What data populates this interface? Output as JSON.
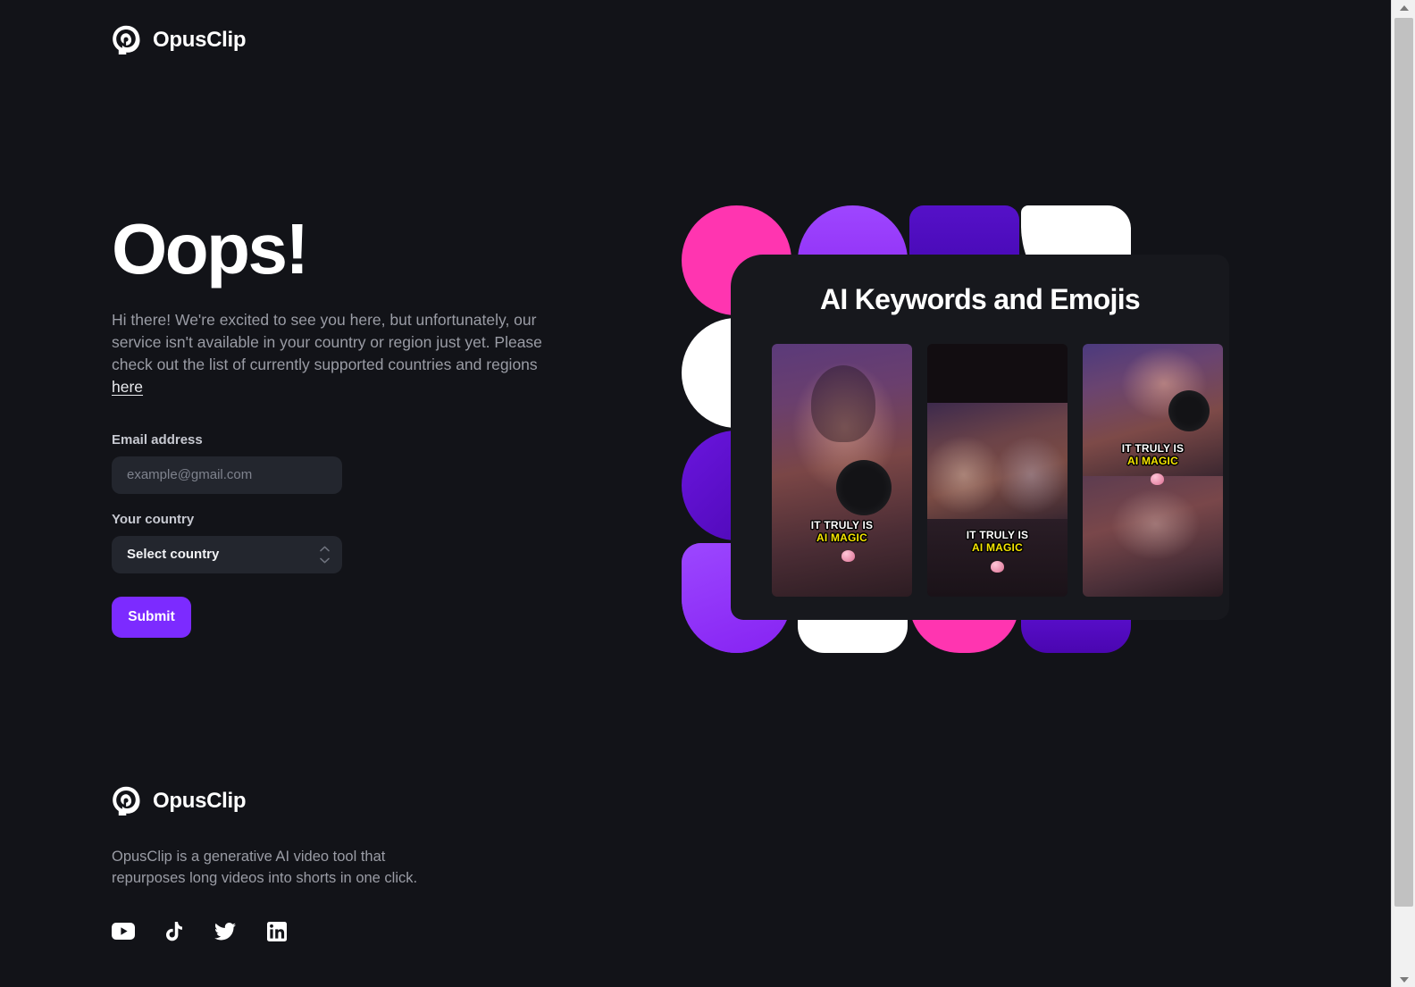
{
  "brand": {
    "name": "OpusClip",
    "logo_icon": "opusclip-p-logo-icon"
  },
  "main": {
    "headline": "Oops!",
    "body_text": "Hi there! We're excited to see you here, but unfortunately, our service isn't available in your country or region just yet. Please check out the list of currently supported countries and regions ",
    "body_link_text": "here"
  },
  "form": {
    "email_label": "Email address",
    "email_placeholder": "example@gmail.com",
    "email_value": "",
    "country_label": "Your country",
    "country_selected": "Select country",
    "country_chevron_up_icon": "chevron-up-icon",
    "country_chevron_down_icon": "chevron-down-icon",
    "submit_label": "Submit",
    "submit_color": "#7C2BFF"
  },
  "hero": {
    "card_title": "AI Keywords and Emojis",
    "thumbnails": [
      {
        "caption_line1": "IT TRULY IS",
        "caption_line2": "AI MAGIC"
      },
      {
        "caption_line1": "IT TRULY IS",
        "caption_line2": "AI MAGIC"
      },
      {
        "caption_line1": "IT TRULY IS",
        "caption_line2": "AI MAGIC"
      }
    ],
    "caption_line1_color": "#FFFFFF",
    "caption_line2_color": "#F5E500",
    "blob_colors": {
      "pink": "#FF35B0",
      "purple": "#9333F5",
      "indigo": "#4E0FB5",
      "bright_purple": "#8B2BF5",
      "white": "#FFFFFF"
    }
  },
  "footer": {
    "brand_name": "OpusClip",
    "description": "OpusClip is a generative AI video tool that repurposes long videos into shorts in one click.",
    "socials": [
      {
        "name": "youtube-icon",
        "label": "YouTube"
      },
      {
        "name": "tiktok-icon",
        "label": "TikTok"
      },
      {
        "name": "twitter-icon",
        "label": "Twitter"
      },
      {
        "name": "linkedin-icon",
        "label": "LinkedIn"
      }
    ]
  },
  "scrollbar": {
    "up_arrow_icon": "scroll-up-arrow-icon",
    "down_arrow_icon": "scroll-down-arrow-icon"
  }
}
